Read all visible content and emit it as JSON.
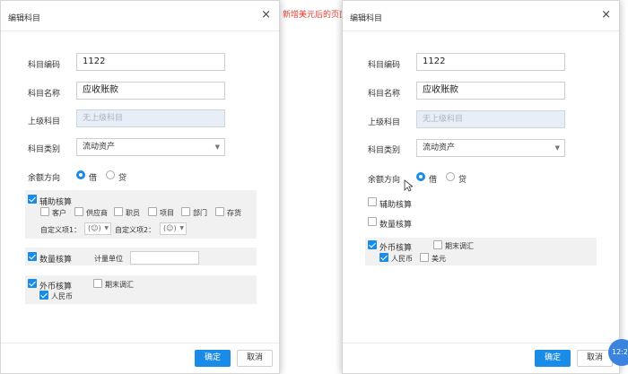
{
  "annotation": {
    "text": "新增美元后的页面"
  },
  "dialog_left": {
    "title": "编辑科目",
    "close": "×",
    "code_label": "科目编码",
    "code_value": "1122",
    "name_label": "科目名称",
    "name_value": "应收账款",
    "parent_label": "上级科目",
    "parent_placeholder": "无上级科目",
    "category_label": "科目类别",
    "category_value": "流动资产",
    "balance_label": "余额方向",
    "debit_label": "借",
    "credit_label": "贷",
    "aux": {
      "label": "辅助核算",
      "items": [
        "客户",
        "供应商",
        "职员",
        "项目",
        "部门",
        "存货"
      ],
      "custom1_label": "自定义项1：",
      "custom2_label": "自定义项2："
    },
    "qty": {
      "label": "数量核算",
      "unit_label": "计量单位"
    },
    "fx": {
      "label": "外币核算",
      "period_end_label": "期末调汇",
      "currencies": [
        "人民币"
      ]
    },
    "ok_label": "确定",
    "cancel_label": "取消"
  },
  "dialog_right": {
    "title": "编辑科目",
    "close": "×",
    "code_label": "科目编码",
    "code_value": "1122",
    "name_label": "科目名称",
    "name_value": "应收账款",
    "parent_label": "上级科目",
    "parent_placeholder": "无上级科目",
    "category_label": "科目类别",
    "category_value": "流动资产",
    "balance_label": "余额方向",
    "debit_label": "借",
    "credit_label": "贷",
    "aux_label": "辅助核算",
    "qty_label": "数量核算",
    "fx": {
      "label": "外币核算",
      "period_end_label": "期末调汇",
      "currencies": [
        "人民币",
        "美元"
      ]
    },
    "ok_label": "确定",
    "cancel_label": "取消"
  },
  "time_badge": "12:2",
  "colors": {
    "accent": "#1a8be6",
    "annotation": "#e43a2e",
    "disabled_bg": "#e8eef6",
    "panel_bg": "#f1f1f1"
  },
  "icons": [
    "close-icon",
    "caret-down-icon",
    "checkbox-checked-icon",
    "radio-selected-icon",
    "mouse-cursor-icon",
    "red-arrow-icon"
  ]
}
